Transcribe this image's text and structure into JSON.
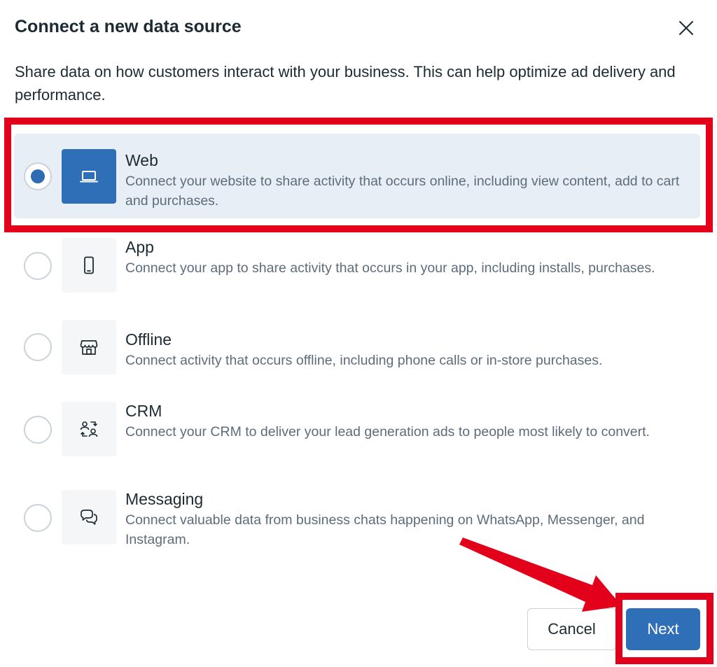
{
  "dialog": {
    "title": "Connect a new data source",
    "subtitle": "Share data on how customers interact with your business. This can help optimize ad delivery and performance."
  },
  "options": [
    {
      "title": "Web",
      "description": "Connect your website to share activity that occurs online, including view content, add to cart and purchases.",
      "icon": "laptop-icon",
      "selected": true
    },
    {
      "title": "App",
      "description": "Connect your app to share activity that occurs in your app, including installs, purchases.",
      "icon": "phone-icon",
      "selected": false
    },
    {
      "title": "Offline",
      "description": "Connect activity that occurs offline, including phone calls or in-store purchases.",
      "icon": "store-icon",
      "selected": false
    },
    {
      "title": "CRM",
      "description": "Connect your CRM to deliver your lead generation ads to people most likely to convert.",
      "icon": "people-sync-icon",
      "selected": false
    },
    {
      "title": "Messaging",
      "description": "Connect valuable data from business chats happening on WhatsApp, Messenger, and Instagram.",
      "icon": "chat-bubbles-icon",
      "selected": false
    }
  ],
  "footer": {
    "cancel_label": "Cancel",
    "next_label": "Next"
  },
  "colors": {
    "primary": "#2f6fb8",
    "selected_bg": "#e7eef5",
    "annotation": "#e2001a"
  }
}
